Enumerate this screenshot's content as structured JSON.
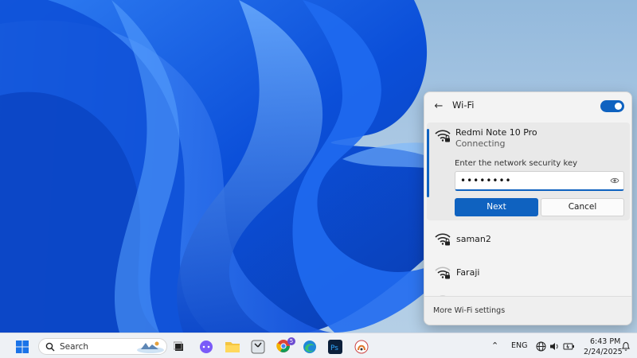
{
  "wifi_panel": {
    "title": "Wi-Fi",
    "toggle_on": true,
    "active_network": {
      "name": "Redmi Note 10 Pro",
      "status": "Connecting",
      "key_prompt": "Enter the network security key",
      "password_masked": "••••••••",
      "next_label": "Next",
      "cancel_label": "Cancel"
    },
    "networks": [
      {
        "name": "saman2",
        "secured": true
      },
      {
        "name": "Faraji",
        "secured": true
      }
    ],
    "more_settings_label": "More Wi-Fi settings"
  },
  "taskbar": {
    "search_label": "Search",
    "language": "ENG",
    "time": "6:43 PM",
    "date": "2/24/2025",
    "chrome_badge": "5",
    "apps": [
      "start-icon",
      "search-icon",
      "task-view-icon",
      "copilot-icon",
      "file-explorer-icon",
      "clock-app-icon",
      "chrome-icon",
      "edge-icon",
      "photoshop-icon",
      "app-icon"
    ]
  },
  "colors": {
    "accent": "#0f62c0",
    "wallpaper_blue": "#1a5ee8"
  }
}
